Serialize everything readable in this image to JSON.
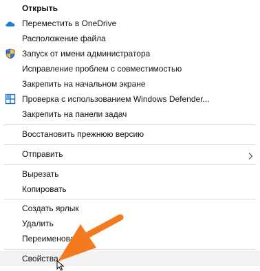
{
  "menu": {
    "items": [
      {
        "label": "Открыть"
      },
      {
        "label": "Переместить в OneDrive",
        "icon": "onedrive-cloud-icon"
      },
      {
        "label": "Расположение файла"
      },
      {
        "label": "Запуск от имени администратора",
        "icon": "uac-shield-icon"
      },
      {
        "label": "Исправление проблем с совместимостью"
      },
      {
        "label": "Закрепить на начальном экране"
      },
      {
        "label": "Проверка с использованием Windows Defender...",
        "icon": "windows-defender-icon"
      },
      {
        "label": "Закрепить на панели задач"
      },
      {
        "label": "Восстановить прежнюю версию"
      },
      {
        "label": "Отправить",
        "icon": "chevron-right-icon"
      },
      {
        "label": "Вырезать"
      },
      {
        "label": "Копировать"
      },
      {
        "label": "Создать ярлык"
      },
      {
        "label": "Удалить"
      },
      {
        "label": "Переименовать"
      },
      {
        "label": "Свойства"
      }
    ]
  },
  "overlay": {
    "arrow_color": "#f47a20",
    "arrow_icon": "orange-pointer-arrow",
    "cursor_icon": "mouse-cursor-icon"
  }
}
